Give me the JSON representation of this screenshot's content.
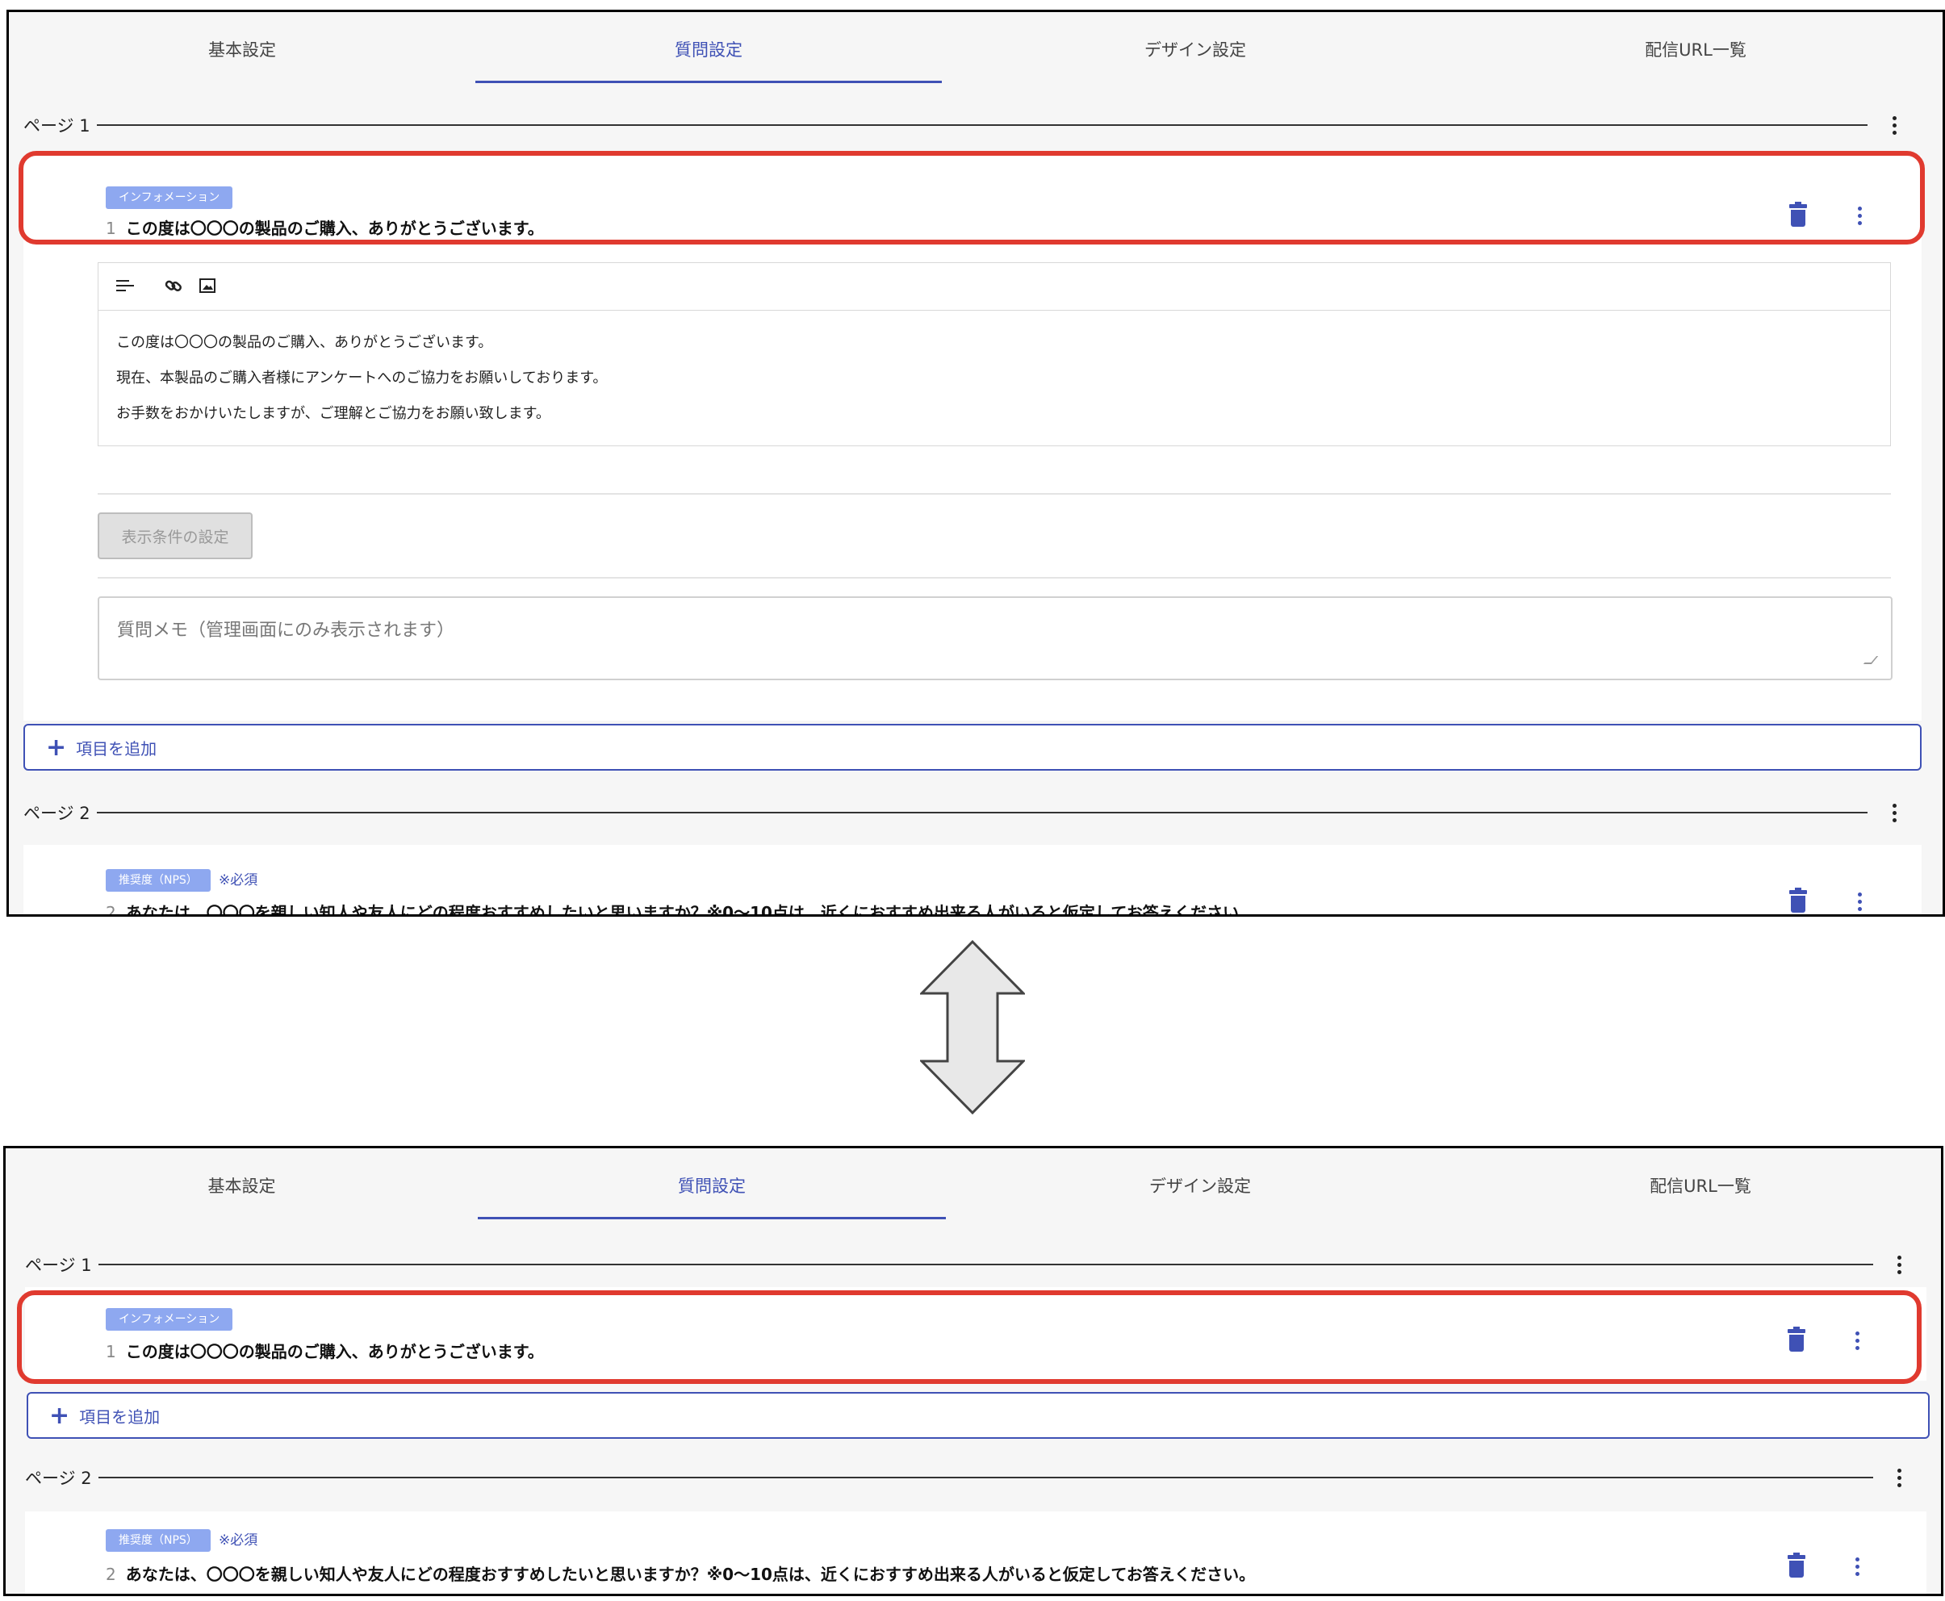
{
  "tabs": [
    "基本設定",
    "質問設定",
    "デザイン設定",
    "配信URL一覧"
  ],
  "active_tab": "質問設定",
  "pages": [
    {
      "label": "ページ 1"
    },
    {
      "label": "ページ 2"
    }
  ],
  "questions": [
    {
      "number": "1",
      "type": "インフォメーション",
      "required": "",
      "text": "この度は〇〇〇の製品のご購入、ありがとうございます。"
    },
    {
      "number": "2",
      "type": "推奨度（NPS）",
      "required": "※必須",
      "text": "あなたは、〇〇〇を親しい知人や友人にどの程度おすすめしたいと思いますか？※0〜10点は、近くにおすすめ出来る人がいると仮定してお答えください。"
    }
  ],
  "editor": {
    "lines": [
      "この度は〇〇〇の製品のご購入、ありがとうございます。",
      "現在、本製品のご購入者様にアンケートへのご協力をお願いしております。",
      "お手数をおかけいたしますが、ご理解とご協力をお願い致します。"
    ]
  },
  "condition_button": "表示条件の設定",
  "memo_placeholder": "質問メモ（管理画面にのみ表示されます）",
  "add_item": "項目を追加",
  "icons": [
    "align-icon",
    "link-icon",
    "image-icon",
    "trash-icon",
    "more-vert-icon",
    "plus-icon",
    "double-arrow-icon"
  ],
  "colors": {
    "accent": "#3f51b5",
    "highlight": "#e03a2f",
    "badge": "#8ea8f0"
  }
}
